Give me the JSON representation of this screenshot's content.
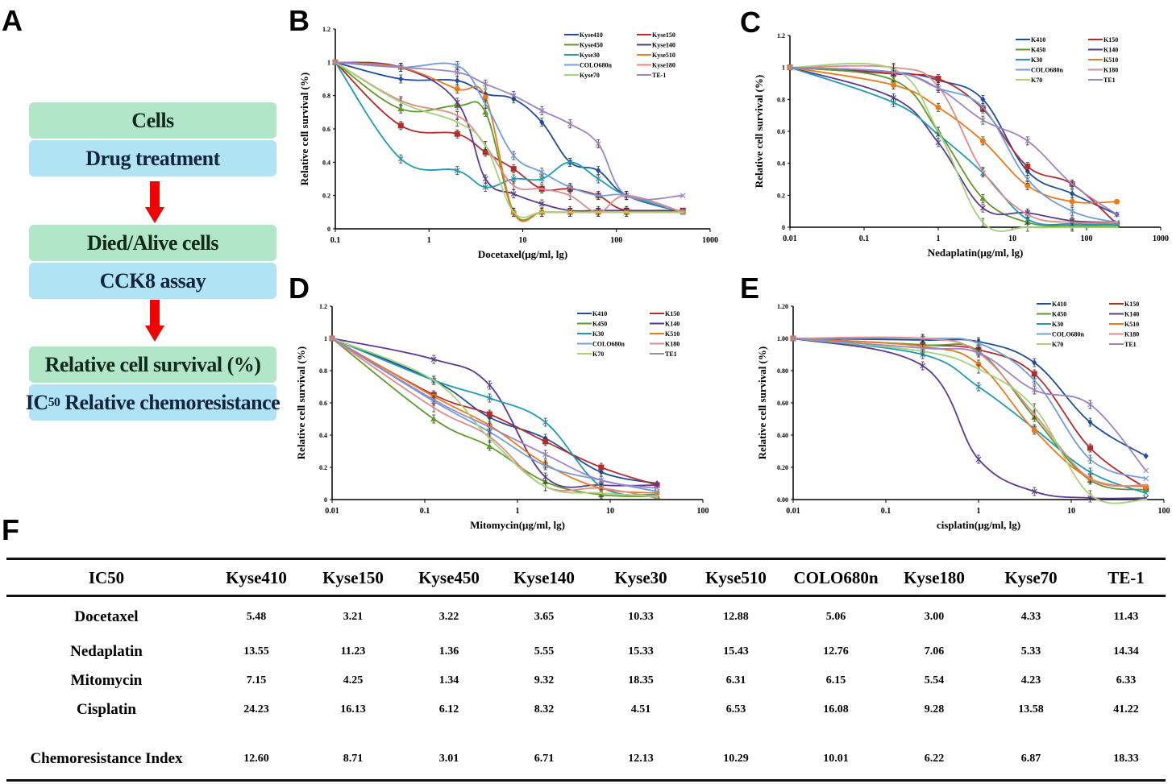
{
  "panels": {
    "A": "A",
    "B": "B",
    "C": "C",
    "D": "D",
    "E": "E",
    "F": "F"
  },
  "flowchart": {
    "steps": [
      {
        "label": "Cells",
        "color": "#b2e6c8"
      },
      {
        "label": "Drug treatment",
        "color": "#b0e4f5"
      },
      {
        "label": "Died/Alive cells",
        "color": "#b2e6c8"
      },
      {
        "label": "CCK8 assay",
        "color": "#b0e4f5"
      },
      {
        "label": "Relative cell survival (%)",
        "color": "#b2e6c8"
      },
      {
        "label_pre": "IC",
        "label_sub": "50",
        "label_post": " Relative chemoresistance",
        "color": "#b0e4f5"
      }
    ],
    "arrow_color": "#f20000"
  },
  "series_colors": {
    "Kyse410": "#1f4e9c",
    "Kyse150": "#b22c2c",
    "Kyse450": "#5f9a2a",
    "Kyse140": "#5b3a93",
    "Kyse30": "#1f9ab3",
    "Kyse510": "#ec7a1a",
    "COLO680n": "#6f9ed8",
    "Kyse180": "#e08a8a",
    "Kyse70": "#a6d27a",
    "TE-1": "#9c84c6"
  },
  "chart_data": [
    {
      "id": "B",
      "type": "line",
      "xscale": "log",
      "xlabel": "Docetaxel(μg/ml, lg)",
      "ylabel": "Relative cell survival (%)",
      "xlim": [
        0.1,
        1000
      ],
      "ylim": [
        0,
        1.2
      ],
      "xticks": [
        "0.1",
        "1",
        "10",
        "100",
        "1000"
      ],
      "yticks": [
        "0",
        "0.2",
        "0.4",
        "0.6",
        "0.8",
        "1",
        "1.2"
      ],
      "legend_position": "top-right",
      "x": [
        0.1,
        0.5,
        2,
        4,
        8,
        16,
        32,
        64,
        128,
        512
      ],
      "series": [
        {
          "name": "Kyse410",
          "key": "Kyse410",
          "values": [
            1.0,
            0.9,
            0.89,
            0.81,
            0.78,
            0.64,
            0.4,
            0.35,
            0.2,
            0.1
          ]
        },
        {
          "name": "Kyse150",
          "key": "Kyse150",
          "values": [
            1.0,
            0.62,
            0.57,
            0.46,
            0.36,
            0.24,
            0.24,
            0.2,
            0.11,
            0.11
          ]
        },
        {
          "name": "Kyse450",
          "key": "Kyse450",
          "values": [
            1.0,
            0.72,
            0.74,
            0.7,
            0.1,
            0.1,
            0.1,
            0.1,
            0.1,
            0.1
          ]
        },
        {
          "name": "Kyse140",
          "key": "Kyse140",
          "values": [
            1.0,
            0.97,
            0.76,
            0.3,
            0.21,
            0.15,
            0.11,
            0.11,
            0.11,
            0.11
          ]
        },
        {
          "name": "Kyse30",
          "key": "Kyse30",
          "values": [
            1.0,
            0.42,
            0.35,
            0.25,
            0.3,
            0.3,
            0.4,
            0.3,
            0.2,
            0.1
          ]
        },
        {
          "name": "Kyse510",
          "key": "Kyse510",
          "values": [
            1.0,
            0.97,
            0.84,
            0.79,
            0.1,
            0.1,
            0.1,
            0.1,
            0.1,
            0.1
          ]
        },
        {
          "name": "COLO680n",
          "key": "COLO680n",
          "values": [
            1.0,
            0.97,
            0.98,
            0.75,
            0.44,
            0.34,
            0.25,
            0.2,
            0.2,
            0.1
          ]
        },
        {
          "name": "Kyse180",
          "key": "Kyse180",
          "values": [
            1.0,
            0.77,
            0.68,
            0.5,
            0.26,
            0.24,
            0.2,
            0.1,
            0.2,
            0.1
          ]
        },
        {
          "name": "Kyse70",
          "key": "Kyse70",
          "values": [
            1.0,
            0.76,
            0.64,
            0.5,
            0.1,
            0.1,
            0.1,
            0.1,
            0.1,
            0.1
          ]
        },
        {
          "name": "TE-1",
          "key": "TE-1",
          "values": [
            1.0,
            0.97,
            0.94,
            0.87,
            0.8,
            0.71,
            0.63,
            0.51,
            0.2,
            0.2
          ]
        }
      ]
    },
    {
      "id": "C",
      "type": "line",
      "xscale": "log",
      "xlabel": "Nedaplatin(μg/ml, lg)",
      "ylabel": "Relative cell survival (%)",
      "xlim": [
        0.01,
        1000
      ],
      "ylim": [
        0,
        1.2
      ],
      "xticks": [
        "0.01",
        "0.1",
        "1",
        "10",
        "100",
        "1000"
      ],
      "yticks": [
        "0",
        "0.2",
        "0.4",
        "0.6",
        "0.8",
        "1",
        "1.2"
      ],
      "legend_position": "top-right",
      "x": [
        0.01,
        0.25,
        1,
        4,
        16,
        64,
        256
      ],
      "series": [
        {
          "name": "K410",
          "key": "Kyse410",
          "values": [
            1.0,
            0.97,
            0.92,
            0.8,
            0.35,
            0.21,
            0.08
          ]
        },
        {
          "name": "K150",
          "key": "Kyse150",
          "values": [
            1.0,
            0.96,
            0.93,
            0.74,
            0.38,
            0.27,
            0.02
          ]
        },
        {
          "name": "K450",
          "key": "Kyse450",
          "values": [
            1.0,
            0.92,
            0.6,
            0.18,
            0.03,
            0.01,
            0.01
          ]
        },
        {
          "name": "K140",
          "key": "Kyse140",
          "values": [
            1.0,
            0.81,
            0.53,
            0.12,
            0.09,
            0.04,
            0.03
          ]
        },
        {
          "name": "K30",
          "key": "Kyse30",
          "values": [
            1.0,
            0.78,
            0.58,
            0.34,
            0.05,
            0.02,
            0.02
          ]
        },
        {
          "name": "K510",
          "key": "Kyse510",
          "values": [
            1.0,
            0.89,
            0.75,
            0.54,
            0.26,
            0.16,
            0.16
          ]
        },
        {
          "name": "COLO680n",
          "key": "COLO680n",
          "values": [
            1.0,
            0.97,
            0.87,
            0.75,
            0.3,
            0.1,
            0.03
          ]
        },
        {
          "name": "K180",
          "key": "Kyse180",
          "values": [
            1.0,
            1.0,
            0.88,
            0.35,
            0.08,
            0.03,
            0.03
          ]
        },
        {
          "name": "K70",
          "key": "Kyse70",
          "values": [
            1.0,
            0.99,
            0.6,
            0.03,
            0.0,
            0.0,
            0.0
          ]
        },
        {
          "name": "TE1",
          "key": "TE-1",
          "values": [
            1.0,
            0.97,
            0.87,
            0.67,
            0.54,
            0.27,
            0.08
          ]
        }
      ]
    },
    {
      "id": "D",
      "type": "line",
      "xscale": "log",
      "xlabel": "Mitomycin(μg/ml, lg)",
      "ylabel": "Relative cell survival (%)",
      "xlim": [
        0.01,
        100
      ],
      "ylim": [
        0,
        1.2
      ],
      "xticks": [
        "0.01",
        "0.1",
        "1",
        "10",
        "100"
      ],
      "yticks": [
        "0",
        "0.2",
        "0.4",
        "0.6",
        "0.8",
        "1",
        "1.2"
      ],
      "legend_position": "top-right",
      "x": [
        0.01,
        0.125,
        0.5,
        2,
        8,
        32
      ],
      "series": [
        {
          "name": "K410",
          "key": "Kyse410",
          "values": [
            1.0,
            0.74,
            0.51,
            0.38,
            0.17,
            0.1
          ]
        },
        {
          "name": "K150",
          "key": "Kyse150",
          "values": [
            1.0,
            0.65,
            0.53,
            0.36,
            0.2,
            0.09
          ]
        },
        {
          "name": "K450",
          "key": "Kyse450",
          "values": [
            1.0,
            0.5,
            0.33,
            0.11,
            0.03,
            0.02
          ]
        },
        {
          "name": "K140",
          "key": "Kyse140",
          "values": [
            1.0,
            0.87,
            0.71,
            0.14,
            0.09,
            0.09
          ]
        },
        {
          "name": "K30",
          "key": "Kyse30",
          "values": [
            1.0,
            0.74,
            0.63,
            0.48,
            0.08,
            0.03
          ]
        },
        {
          "name": "K510",
          "key": "Kyse510",
          "values": [
            1.0,
            0.64,
            0.46,
            0.22,
            0.07,
            0.04
          ]
        },
        {
          "name": "COLO680n",
          "key": "COLO680n",
          "values": [
            1.0,
            0.61,
            0.42,
            0.21,
            0.12,
            0.05
          ]
        },
        {
          "name": "K180",
          "key": "Kyse180",
          "values": [
            1.0,
            0.57,
            0.39,
            0.08,
            0.07,
            0.01
          ]
        },
        {
          "name": "K70",
          "key": "Kyse70",
          "values": [
            1.0,
            0.74,
            0.38,
            0.08,
            0.04,
            0.02
          ]
        },
        {
          "name": "TE1",
          "key": "TE-1",
          "values": [
            1.0,
            0.62,
            0.45,
            0.28,
            0.12,
            0.07
          ]
        }
      ]
    },
    {
      "id": "E",
      "type": "line",
      "xscale": "log",
      "xlabel": "cisplatin(μg/ml, lg)",
      "ylabel": "Relative cell survival (%)",
      "xlim": [
        0.01,
        100
      ],
      "ylim": [
        0,
        1.2
      ],
      "xticks": [
        "0.01",
        "0.1",
        "1",
        "10",
        "100"
      ],
      "yticks": [
        "0.00",
        "0.20",
        "0.40",
        "0.60",
        "0.80",
        "1.00",
        "1.20"
      ],
      "legend_position": "top-right",
      "x": [
        0.01,
        0.25,
        1,
        4,
        16,
        64
      ],
      "series": [
        {
          "name": "K410",
          "key": "Kyse410",
          "values": [
            1.0,
            0.99,
            0.98,
            0.85,
            0.48,
            0.27
          ]
        },
        {
          "name": "K150",
          "key": "Kyse150",
          "values": [
            1.0,
            0.96,
            0.93,
            0.78,
            0.32,
            0.07
          ]
        },
        {
          "name": "K450",
          "key": "Kyse450",
          "values": [
            1.0,
            0.96,
            0.92,
            0.51,
            0.12,
            0.06
          ]
        },
        {
          "name": "K140",
          "key": "Kyse140",
          "values": [
            1.0,
            0.83,
            0.25,
            0.05,
            0.01,
            0.01
          ]
        },
        {
          "name": "K30",
          "key": "Kyse30",
          "values": [
            1.0,
            0.9,
            0.7,
            0.44,
            0.17,
            0.04
          ]
        },
        {
          "name": "K510",
          "key": "Kyse510",
          "values": [
            1.0,
            0.95,
            0.84,
            0.43,
            0.13,
            0.08
          ]
        },
        {
          "name": "COLO680n",
          "key": "COLO680n",
          "values": [
            1.0,
            1.0,
            0.97,
            0.74,
            0.25,
            0.13
          ]
        },
        {
          "name": "K180",
          "key": "Kyse180",
          "values": [
            1.0,
            1.0,
            0.91,
            0.53,
            0.13,
            0.09
          ]
        },
        {
          "name": "K70",
          "key": "Kyse70",
          "values": [
            1.0,
            0.92,
            0.81,
            0.57,
            0.03,
            0.0
          ]
        },
        {
          "name": "TE1",
          "key": "TE-1",
          "values": [
            1.0,
            0.94,
            0.91,
            0.68,
            0.59,
            0.18
          ]
        }
      ]
    },
    {
      "id": "F",
      "type": "table",
      "columns": [
        "IC50",
        "Kyse410",
        "Kyse150",
        "Kyse450",
        "Kyse140",
        "Kyse30",
        "Kyse510",
        "COLO680n",
        "Kyse180",
        "Kyse70",
        "TE-1"
      ],
      "rows": [
        {
          "label": "Docetaxel",
          "values": [
            "5.48",
            "3.21",
            "3.22",
            "3.65",
            "10.33",
            "12.88",
            "5.06",
            "3.00",
            "4.33",
            "11.43"
          ]
        },
        {
          "label": "Nedaplatin",
          "values": [
            "13.55",
            "11.23",
            "1.36",
            "5.55",
            "15.33",
            "15.43",
            "12.76",
            "7.06",
            "5.33",
            "14.34"
          ]
        },
        {
          "label": "Mitomycin",
          "values": [
            "7.15",
            "4.25",
            "1.34",
            "9.32",
            "18.35",
            "6.31",
            "6.15",
            "5.54",
            "4.23",
            "6.33"
          ]
        },
        {
          "label": "Cisplatin",
          "values": [
            "24.23",
            "16.13",
            "6.12",
            "8.32",
            "4.51",
            "6.53",
            "16.08",
            "9.28",
            "13.58",
            "41.22"
          ]
        },
        {
          "label": "Chemoresistance Index",
          "values": [
            "12.60",
            "8.71",
            "3.01",
            "6.71",
            "12.13",
            "10.29",
            "10.01",
            "6.22",
            "6.87",
            "18.33"
          ]
        }
      ]
    }
  ]
}
